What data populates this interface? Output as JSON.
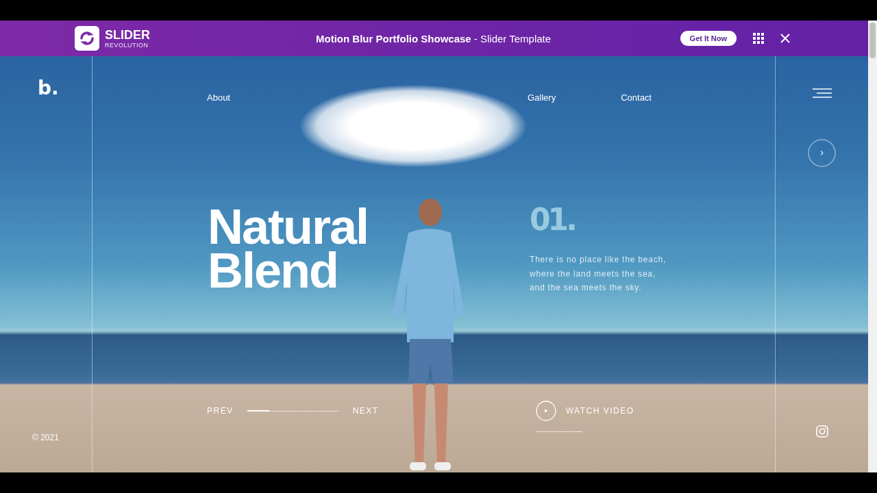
{
  "topbar": {
    "brand": "SLIDER",
    "brand_sub": "REVOLUTION",
    "title": "**Motion Blur Portfolio Showcase** - Slider Template",
    "cta": "Get It Now"
  },
  "hero": {
    "logo": "b.",
    "copyright": "© 2021",
    "nav": [
      {
        "label": "About"
      },
      {
        "label": "Gallery"
      },
      {
        "label": "Contact"
      }
    ],
    "headline": "Natural Blend",
    "number": "01.",
    "description": "There is no place like the beach, where the land meets the sea, and the sea meets the sky.",
    "prev": "PREV",
    "next": "NEXT",
    "progress": {
      "level": 0.24
    },
    "watch": "WATCH VIDEO"
  }
}
